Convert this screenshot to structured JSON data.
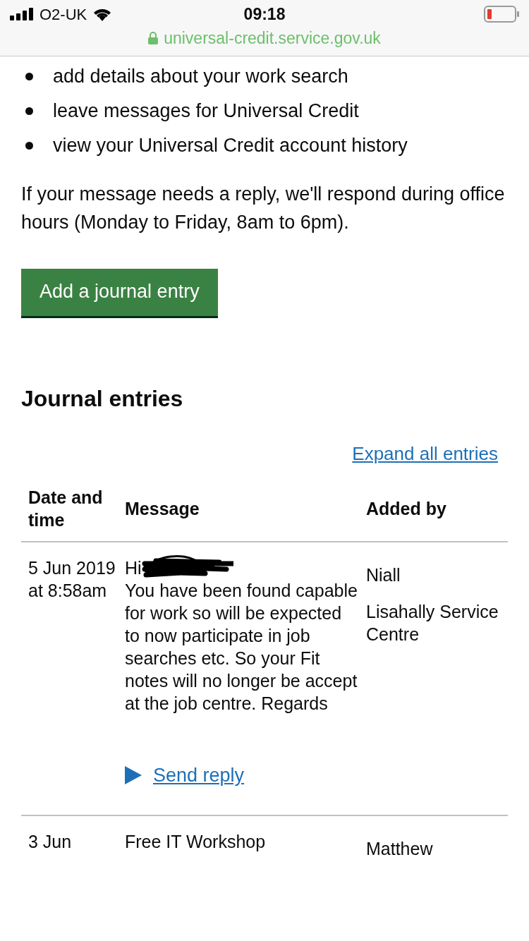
{
  "status_bar": {
    "carrier": "O2-UK",
    "time": "09:18"
  },
  "address_bar": {
    "url": "universal-credit.service.gov.uk"
  },
  "bullets": [
    "add details about your work search",
    "leave messages for Universal Credit",
    "view your Universal Credit account history"
  ],
  "paragraph": "If your message needs a reply, we'll respond during office hours (Monday to Friday, 8am to 6pm).",
  "add_button": "Add a journal entry",
  "heading": "Journal entries",
  "expand_link": "Expand all entries",
  "table": {
    "columns": [
      "Date and time",
      "Message",
      "Added by"
    ],
    "rows": [
      {
        "date": "5 Jun 2019 at 8:58am",
        "greeting": "Hi",
        "redacted": true,
        "message": "You have been found capable for work so will be expected to now participate in job searches etc. So your Fit notes will no longer be accept at the job centre. Regards",
        "added_by": [
          "Niall",
          "Lisahally Service Centre"
        ],
        "reply_link": "Send reply"
      },
      {
        "date": "3 Jun",
        "message": "Free IT Workshop",
        "added_by": [
          "Matthew"
        ]
      }
    ]
  }
}
